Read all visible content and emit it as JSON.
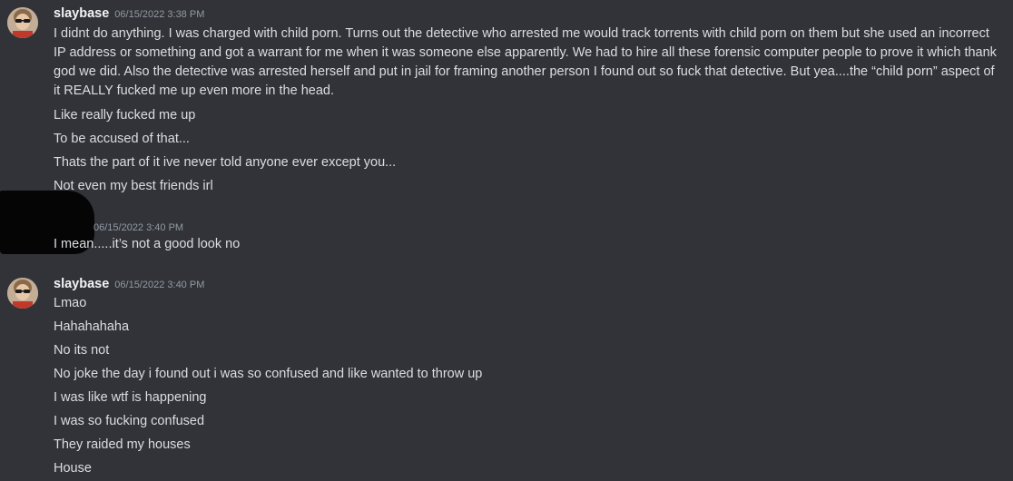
{
  "messages": [
    {
      "username": "slaybase",
      "timestamp": "06/15/2022 3:38 PM",
      "lines": [
        "I didnt do anything. I was charged with child porn.  Turns out the detective who arrested me would track torrents with child porn on them but she used an incorrect IP address or something and got a warrant for me when it was someone else apparently.  We had to hire all these forensic computer people to prove it which thank god we did.  Also the detective was arrested herself and put in jail for framing another person I found out so fuck that detective.   But yea....the “child porn” aspect of it REALLY fucked me up even more in the head.",
        "Like really fucked me up",
        "To be accused of that...",
        "Thats the part of it ive never told anyone ever except you...",
        "Not even my best friends irl"
      ]
    },
    {
      "username": "",
      "timestamp": "06/15/2022 3:40 PM",
      "lines": [
        "I mean.....it’s not a good look no"
      ]
    },
    {
      "username": "slaybase",
      "timestamp": "06/15/2022 3:40 PM",
      "lines": [
        "Lmao",
        "Hahahahaha",
        "No its not",
        "No joke the day i found out i was so confused and like wanted to throw up",
        "I was like wtf is happening",
        "I was so fucking confused",
        "They raided my houses",
        "House"
      ]
    }
  ]
}
